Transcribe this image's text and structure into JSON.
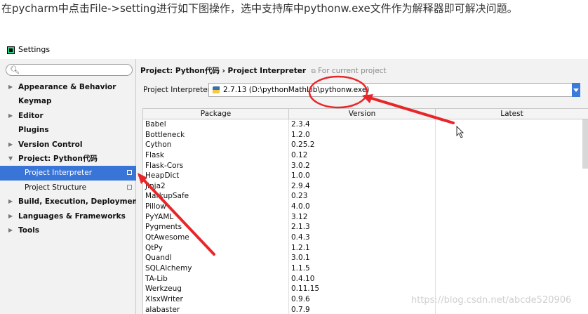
{
  "caption": "在pycharm中点击File->setting进行如下图操作，选中支持库中pythonw.exe文件作为解释器即可解决问题。",
  "window": {
    "title": "Settings"
  },
  "search": {
    "placeholder": ""
  },
  "sidebar": {
    "items": [
      {
        "label": "Appearance & Behavior",
        "arrow": "▶"
      },
      {
        "label": "Keymap",
        "arrow": ""
      },
      {
        "label": "Editor",
        "arrow": "▶"
      },
      {
        "label": "Plugins",
        "arrow": ""
      },
      {
        "label": "Version Control",
        "arrow": "▶"
      },
      {
        "label": "Project: Python代码",
        "arrow": "▼"
      },
      {
        "label": "Project Interpreter",
        "arrow": ""
      },
      {
        "label": "Project Structure",
        "arrow": ""
      },
      {
        "label": "Build, Execution, Deployment",
        "arrow": "▶"
      },
      {
        "label": "Languages & Frameworks",
        "arrow": "▶"
      },
      {
        "label": "Tools",
        "arrow": "▶"
      }
    ]
  },
  "breadcrumb": {
    "project": "Project: Python代码",
    "separator": " › ",
    "page": "Project Interpreter",
    "hint": "For current project"
  },
  "interpreter": {
    "label": "Project Interpreter:",
    "value": "2.7.13 (D:\\pythonMathLib\\pythonw.exe)"
  },
  "table": {
    "headers": [
      "Package",
      "Version",
      "Latest"
    ],
    "rows": [
      [
        "Babel",
        "2.3.4"
      ],
      [
        "Bottleneck",
        "1.2.0"
      ],
      [
        "Cython",
        "0.25.2"
      ],
      [
        "Flask",
        "0.12"
      ],
      [
        "Flask-Cors",
        "3.0.2"
      ],
      [
        "HeapDict",
        "1.0.0"
      ],
      [
        "Jinja2",
        "2.9.4"
      ],
      [
        "MarkupSafe",
        "0.23"
      ],
      [
        "Pillow",
        "4.0.0"
      ],
      [
        "PyYAML",
        "3.12"
      ],
      [
        "Pygments",
        "2.1.3"
      ],
      [
        "QtAwesome",
        "0.4.3"
      ],
      [
        "QtPy",
        "1.2.1"
      ],
      [
        "Quandl",
        "3.0.1"
      ],
      [
        "SQLAlchemy",
        "1.1.5"
      ],
      [
        "TA-Lib",
        "0.4.10"
      ],
      [
        "Werkzeug",
        "0.11.15"
      ],
      [
        "XlsxWriter",
        "0.9.6"
      ],
      [
        "alabaster",
        "0.7.9"
      ]
    ]
  },
  "watermark": "https://blog.csdn.net/abcde520906",
  "colors": {
    "selection": "#3875d7",
    "annotation": "#e8262a",
    "dropdown": "#3c7bd9"
  }
}
